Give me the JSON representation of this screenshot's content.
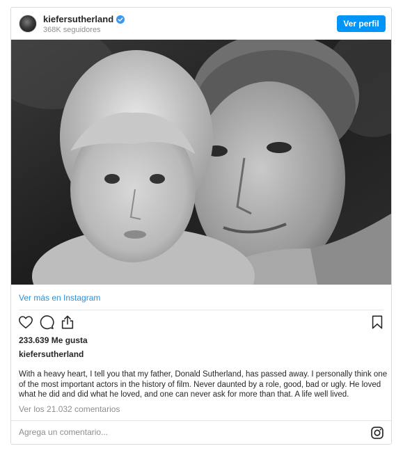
{
  "header": {
    "username": "kiefersutherland",
    "followers": "368K seguidores",
    "profile_button": "Ver perfil"
  },
  "post": {
    "view_more": "Ver más en Instagram",
    "likes": "233.639 Me gusta",
    "caption_username": "kiefersutherland",
    "caption": "With a heavy heart, I tell you that my father, Donald Sutherland, has passed away. I personally think one of the most important actors in the history of film. Never daunted by a role, good, bad or ugly. He loved what he did and did what he loved, and one can never ask for more than that. A life well lived.",
    "comments_link": "Ver los 21.032 comentarios"
  },
  "comment_bar": {
    "placeholder": "Agrega un comentario..."
  },
  "colors": {
    "accent": "#0095f6",
    "link": "#2b8fd8",
    "muted": "#8e8e8e",
    "border": "#dbdbdb"
  },
  "icons": [
    "verified-badge-icon",
    "heart-icon",
    "comment-icon",
    "share-icon",
    "bookmark-icon",
    "instagram-icon"
  ]
}
